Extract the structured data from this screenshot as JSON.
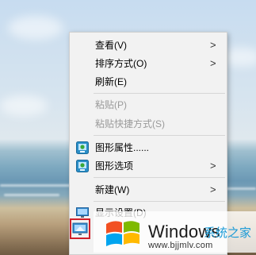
{
  "context_menu": {
    "items": [
      {
        "label": "查看(V)",
        "has_submenu": true,
        "enabled": true
      },
      {
        "label": "排序方式(O)",
        "has_submenu": true,
        "enabled": true
      },
      {
        "label": "刷新(E)",
        "has_submenu": false,
        "enabled": true
      },
      {
        "label": "粘贴(P)",
        "has_submenu": false,
        "enabled": false
      },
      {
        "label": "粘贴快捷方式(S)",
        "has_submenu": false,
        "enabled": false
      },
      {
        "label": "图形属性......",
        "has_submenu": false,
        "enabled": true,
        "icon": "graphics-icon"
      },
      {
        "label": "图形选项",
        "has_submenu": true,
        "enabled": true,
        "icon": "graphics-icon"
      },
      {
        "label": "新建(W)",
        "has_submenu": true,
        "enabled": true
      },
      {
        "label": "显示设置(D)",
        "has_submenu": false,
        "enabled": true,
        "icon": "display-settings-icon"
      }
    ],
    "submenu_glyph": ">"
  },
  "watermark": {
    "brand": "Windows",
    "cn_text": "系统之家",
    "url": "www.bjjmlv.com",
    "logo_colors": [
      "#f25022",
      "#7fba00",
      "#00a4ef",
      "#ffb900"
    ]
  },
  "highlight_color": "#d0202a"
}
